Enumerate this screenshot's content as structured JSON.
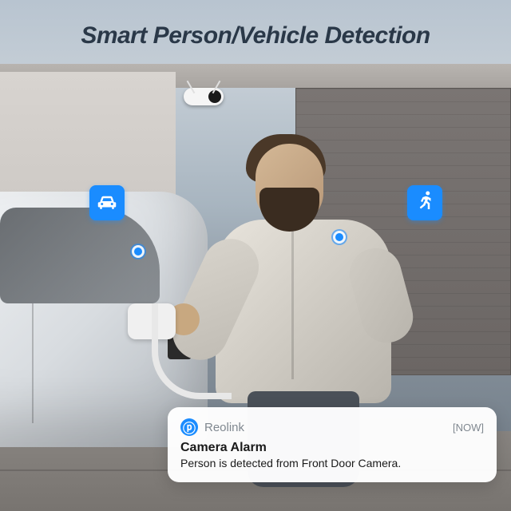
{
  "title": "Smart Person/Vehicle Detection",
  "badges": {
    "car": "car-icon",
    "person": "running-person-icon"
  },
  "notification": {
    "app_name": "Reolink",
    "time_label": "[NOW]",
    "title": "Camera Alarm",
    "message": "Person is detected from Front Door Camera."
  }
}
